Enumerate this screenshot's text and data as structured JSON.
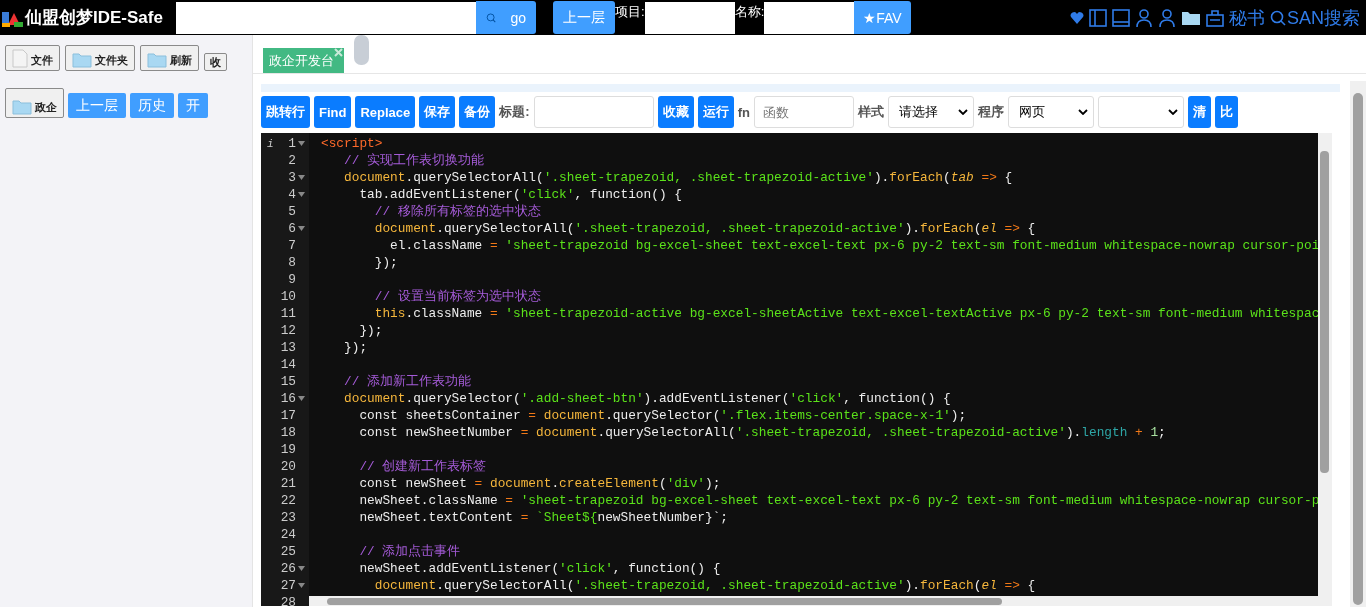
{
  "header": {
    "logo_text": "仙盟创梦IDE-Safe",
    "search": {
      "button": "go"
    },
    "up_button": "上一层",
    "project_label": "项目:",
    "name_label": "名称:",
    "fav_button": "★FAV",
    "secretary": "秘书",
    "san_search": "SAN搜索"
  },
  "sidebar": {
    "row1": [
      "文件",
      "文件夹",
      "刷新"
    ],
    "collapse_button": "收",
    "folder_button": "政企",
    "row2": [
      "上一层",
      "历史",
      "开"
    ]
  },
  "tabs": [
    {
      "label": "政企开发台",
      "selected": true
    }
  ],
  "toolbar": {
    "buttons_left": [
      "跳转行",
      "Find",
      "Replace",
      "保存",
      "备份"
    ],
    "title_label": "标题:",
    "buttons_mid": [
      "收藏",
      "运行"
    ],
    "fn_label": "fn",
    "fn_field": {
      "placeholder": "函数"
    },
    "style_label": "样式",
    "style_select": "请选择",
    "program_label": "程序",
    "program_select": "网页",
    "buttons_right": [
      "清",
      "比"
    ]
  },
  "editor": {
    "gutter_mark": "i",
    "lines": [
      {
        "n": "1",
        "fold": true,
        "tokens": [
          {
            "kind": "tag",
            "text": "<script>"
          }
        ]
      },
      {
        "n": "2",
        "tokens": [
          {
            "kind": "cm",
            "text": "   // 实现工作表切换功能"
          }
        ]
      },
      {
        "n": "3",
        "fold": true,
        "tokens": [
          {
            "kind": "gl",
            "text": "   document"
          },
          {
            "kind": "pl",
            "text": ".querySelectorAll("
          },
          {
            "kind": "str",
            "text": "'.sheet-trapezoid, .sheet-trapezoid-active'"
          },
          {
            "kind": "pl",
            "text": ")."
          },
          {
            "kind": "fn",
            "text": "forEach"
          },
          {
            "kind": "pl",
            "text": "("
          },
          {
            "kind": "par",
            "text": "tab"
          },
          {
            "kind": "op",
            "text": " =>"
          },
          {
            "kind": "pl",
            "text": " {"
          }
        ]
      },
      {
        "n": "4",
        "fold": true,
        "tokens": [
          {
            "kind": "pl",
            "text": "     tab.addEventListener("
          },
          {
            "kind": "str",
            "text": "'click'"
          },
          {
            "kind": "pl",
            "text": ", function() {"
          }
        ]
      },
      {
        "n": "5",
        "tokens": [
          {
            "kind": "cm",
            "text": "       // 移除所有标签的选中状态"
          }
        ]
      },
      {
        "n": "6",
        "fold": true,
        "tokens": [
          {
            "kind": "gl",
            "text": "       document"
          },
          {
            "kind": "pl",
            "text": ".querySelectorAll("
          },
          {
            "kind": "str",
            "text": "'.sheet-trapezoid, .sheet-trapezoid-active'"
          },
          {
            "kind": "pl",
            "text": ")."
          },
          {
            "kind": "fn",
            "text": "forEach"
          },
          {
            "kind": "pl",
            "text": "("
          },
          {
            "kind": "par",
            "text": "el"
          },
          {
            "kind": "op",
            "text": " =>"
          },
          {
            "kind": "pl",
            "text": " {"
          }
        ]
      },
      {
        "n": "7",
        "tokens": [
          {
            "kind": "pl",
            "text": "         el.className"
          },
          {
            "kind": "op",
            "text": " ="
          },
          {
            "kind": "str",
            "text": " 'sheet-trapezoid bg-excel-sheet text-excel-text px-6 py-2 text-sm font-medium whitespace-nowrap cursor-poi"
          }
        ]
      },
      {
        "n": "8",
        "tokens": [
          {
            "kind": "pl",
            "text": "       });"
          }
        ]
      },
      {
        "n": "9"
      },
      {
        "n": "10",
        "tokens": [
          {
            "kind": "cm",
            "text": "       // 设置当前标签为选中状态"
          }
        ]
      },
      {
        "n": "11",
        "tokens": [
          {
            "kind": "gl",
            "text": "       this"
          },
          {
            "kind": "pl",
            "text": ".className"
          },
          {
            "kind": "op",
            "text": " ="
          },
          {
            "kind": "str",
            "text": " 'sheet-trapezoid-active bg-excel-sheetActive text-excel-textActive px-6 py-2 text-sm font-medium whitespac"
          }
        ]
      },
      {
        "n": "12",
        "tokens": [
          {
            "kind": "pl",
            "text": "     });"
          }
        ]
      },
      {
        "n": "13",
        "tokens": [
          {
            "kind": "pl",
            "text": "   });"
          }
        ]
      },
      {
        "n": "14"
      },
      {
        "n": "15",
        "tokens": [
          {
            "kind": "cm",
            "text": "   // 添加新工作表功能"
          }
        ]
      },
      {
        "n": "16",
        "fold": true,
        "tokens": [
          {
            "kind": "gl",
            "text": "   document"
          },
          {
            "kind": "pl",
            "text": ".querySelector("
          },
          {
            "kind": "str",
            "text": "'.add-sheet-btn'"
          },
          {
            "kind": "pl",
            "text": ").addEventListener("
          },
          {
            "kind": "str",
            "text": "'click'"
          },
          {
            "kind": "pl",
            "text": ", function() {"
          }
        ]
      },
      {
        "n": "17",
        "tokens": [
          {
            "kind": "pl",
            "text": "     const sheetsContainer"
          },
          {
            "kind": "op",
            "text": " ="
          },
          {
            "kind": "gl",
            "text": " document"
          },
          {
            "kind": "pl",
            "text": ".querySelector("
          },
          {
            "kind": "str",
            "text": "'.flex.items-center.space-x-1'"
          },
          {
            "kind": "pl",
            "text": ");"
          }
        ]
      },
      {
        "n": "18",
        "tokens": [
          {
            "kind": "pl",
            "text": "     const newSheetNumber"
          },
          {
            "kind": "op",
            "text": " ="
          },
          {
            "kind": "gl",
            "text": " document"
          },
          {
            "kind": "pl",
            "text": ".querySelectorAll("
          },
          {
            "kind": "str",
            "text": "'.sheet-trapezoid, .sheet-trapezoid-active'"
          },
          {
            "kind": "pl",
            "text": ")."
          },
          {
            "kind": "prop",
            "text": "length"
          },
          {
            "kind": "op",
            "text": " +"
          },
          {
            "kind": "num",
            "text": " 1"
          },
          {
            "kind": "pl",
            "text": ";"
          }
        ]
      },
      {
        "n": "19"
      },
      {
        "n": "20",
        "tokens": [
          {
            "kind": "cm",
            "text": "     // 创建新工作表标签"
          }
        ]
      },
      {
        "n": "21",
        "tokens": [
          {
            "kind": "pl",
            "text": "     const newSheet"
          },
          {
            "kind": "op",
            "text": " ="
          },
          {
            "kind": "gl",
            "text": " document"
          },
          {
            "kind": "pl",
            "text": "."
          },
          {
            "kind": "fn",
            "text": "createElement"
          },
          {
            "kind": "pl",
            "text": "("
          },
          {
            "kind": "str",
            "text": "'div'"
          },
          {
            "kind": "pl",
            "text": ");"
          }
        ]
      },
      {
        "n": "22",
        "tokens": [
          {
            "kind": "pl",
            "text": "     newSheet.className"
          },
          {
            "kind": "op",
            "text": " ="
          },
          {
            "kind": "str",
            "text": " 'sheet-trapezoid bg-excel-sheet text-excel-text px-6 py-2 text-sm font-medium whitespace-nowrap cursor-p"
          }
        ]
      },
      {
        "n": "23",
        "tokens": [
          {
            "kind": "pl",
            "text": "     newSheet.textContent"
          },
          {
            "kind": "op",
            "text": " ="
          },
          {
            "kind": "str",
            "text": " `Sheet${"
          },
          {
            "kind": "pl",
            "text": "newSheetNumber}`;"
          }
        ]
      },
      {
        "n": "24"
      },
      {
        "n": "25",
        "tokens": [
          {
            "kind": "cm",
            "text": "     // 添加点击事件"
          }
        ]
      },
      {
        "n": "26",
        "fold": true,
        "tokens": [
          {
            "kind": "pl",
            "text": "     newSheet.addEventListener("
          },
          {
            "kind": "str",
            "text": "'click'"
          },
          {
            "kind": "pl",
            "text": ", function() {"
          }
        ]
      },
      {
        "n": "27",
        "fold": true,
        "tokens": [
          {
            "kind": "gl",
            "text": "       document"
          },
          {
            "kind": "pl",
            "text": ".querySelectorAll("
          },
          {
            "kind": "str",
            "text": "'.sheet-trapezoid, .sheet-trapezoid-active'"
          },
          {
            "kind": "pl",
            "text": ")."
          },
          {
            "kind": "fn",
            "text": "forEach"
          },
          {
            "kind": "pl",
            "text": "("
          },
          {
            "kind": "par",
            "text": "el"
          },
          {
            "kind": "op",
            "text": " =>"
          },
          {
            "kind": "pl",
            "text": " {"
          }
        ]
      },
      {
        "n": "28"
      }
    ]
  }
}
